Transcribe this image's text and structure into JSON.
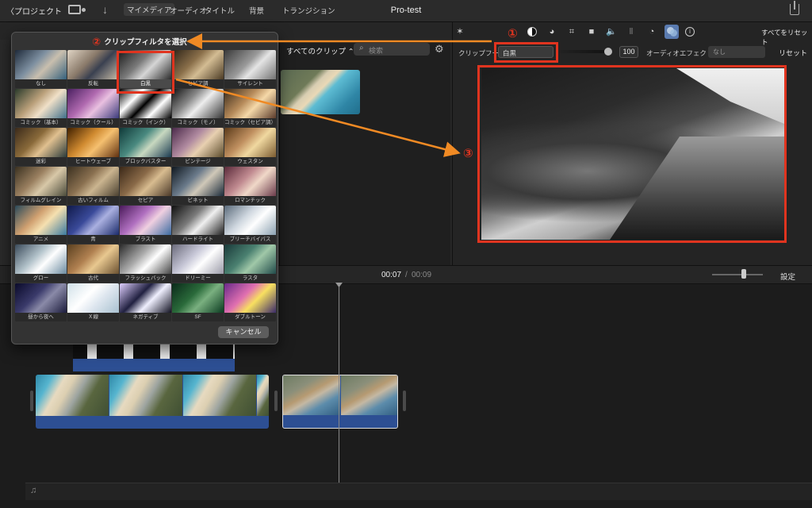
{
  "topbar": {
    "back_label": "〈プロジェクト",
    "title": "Pro-test"
  },
  "library": {
    "tabs": [
      "マイメディア",
      "オーディオ",
      "タイトル",
      "背景",
      "トランジション"
    ],
    "clip_selector": "すべてのクリップ ⌃",
    "search_placeholder": "検索"
  },
  "inspector": {
    "reset_all": "すべてをリセット",
    "clip_filter_label": "クリップフー...",
    "clip_filter_value": "白黒",
    "filter_amount": "100",
    "audio_effect_label": "オーディオエフェクト:",
    "audio_effect_value": "なし",
    "reset": "リセット"
  },
  "timeline": {
    "current_time": "00:07",
    "separator": "/",
    "total_time": "00:09",
    "settings": "設定"
  },
  "filter_picker": {
    "title": "クリップフィルタを選択",
    "selected": "白黒",
    "cancel": "キャンセル",
    "filters": [
      "なし",
      "反転",
      "白黒",
      "セピア調",
      "サイレント",
      "コミック（基本）",
      "コミック（クール）",
      "コミック（インク）",
      "コミック（モノ）",
      "コミック（セピア調）",
      "迷彩",
      "ヒートウェーブ",
      "ブロックバスター",
      "ビンテージ",
      "ウェスタン",
      "フィルムグレイン",
      "古いフィルム",
      "セピア",
      "ビネット",
      "ロマンチック",
      "アニメ",
      "青",
      "ブラスト",
      "ハードライト",
      "ブリーチバイパス",
      "グロー",
      "古代",
      "フラッシュバック",
      "ドリーミー",
      "ラスタ",
      "昼から夜へ",
      "Ｘ線",
      "ネガティブ",
      "SF",
      "ダブルトーン"
    ]
  },
  "annotations": {
    "step1": "①",
    "step2": "②",
    "step3": "③",
    "color": "#e0341f",
    "arrow_color": "#f08a24"
  },
  "icons": {
    "volume": "🔈",
    "equalizer": "Ⅱ",
    "speed": "◔",
    "info": "i",
    "music": "♫"
  },
  "colors": {
    "accent_blue": "#2d4f93",
    "annotation_red": "#e0341f",
    "annotation_orange": "#f08a24"
  }
}
